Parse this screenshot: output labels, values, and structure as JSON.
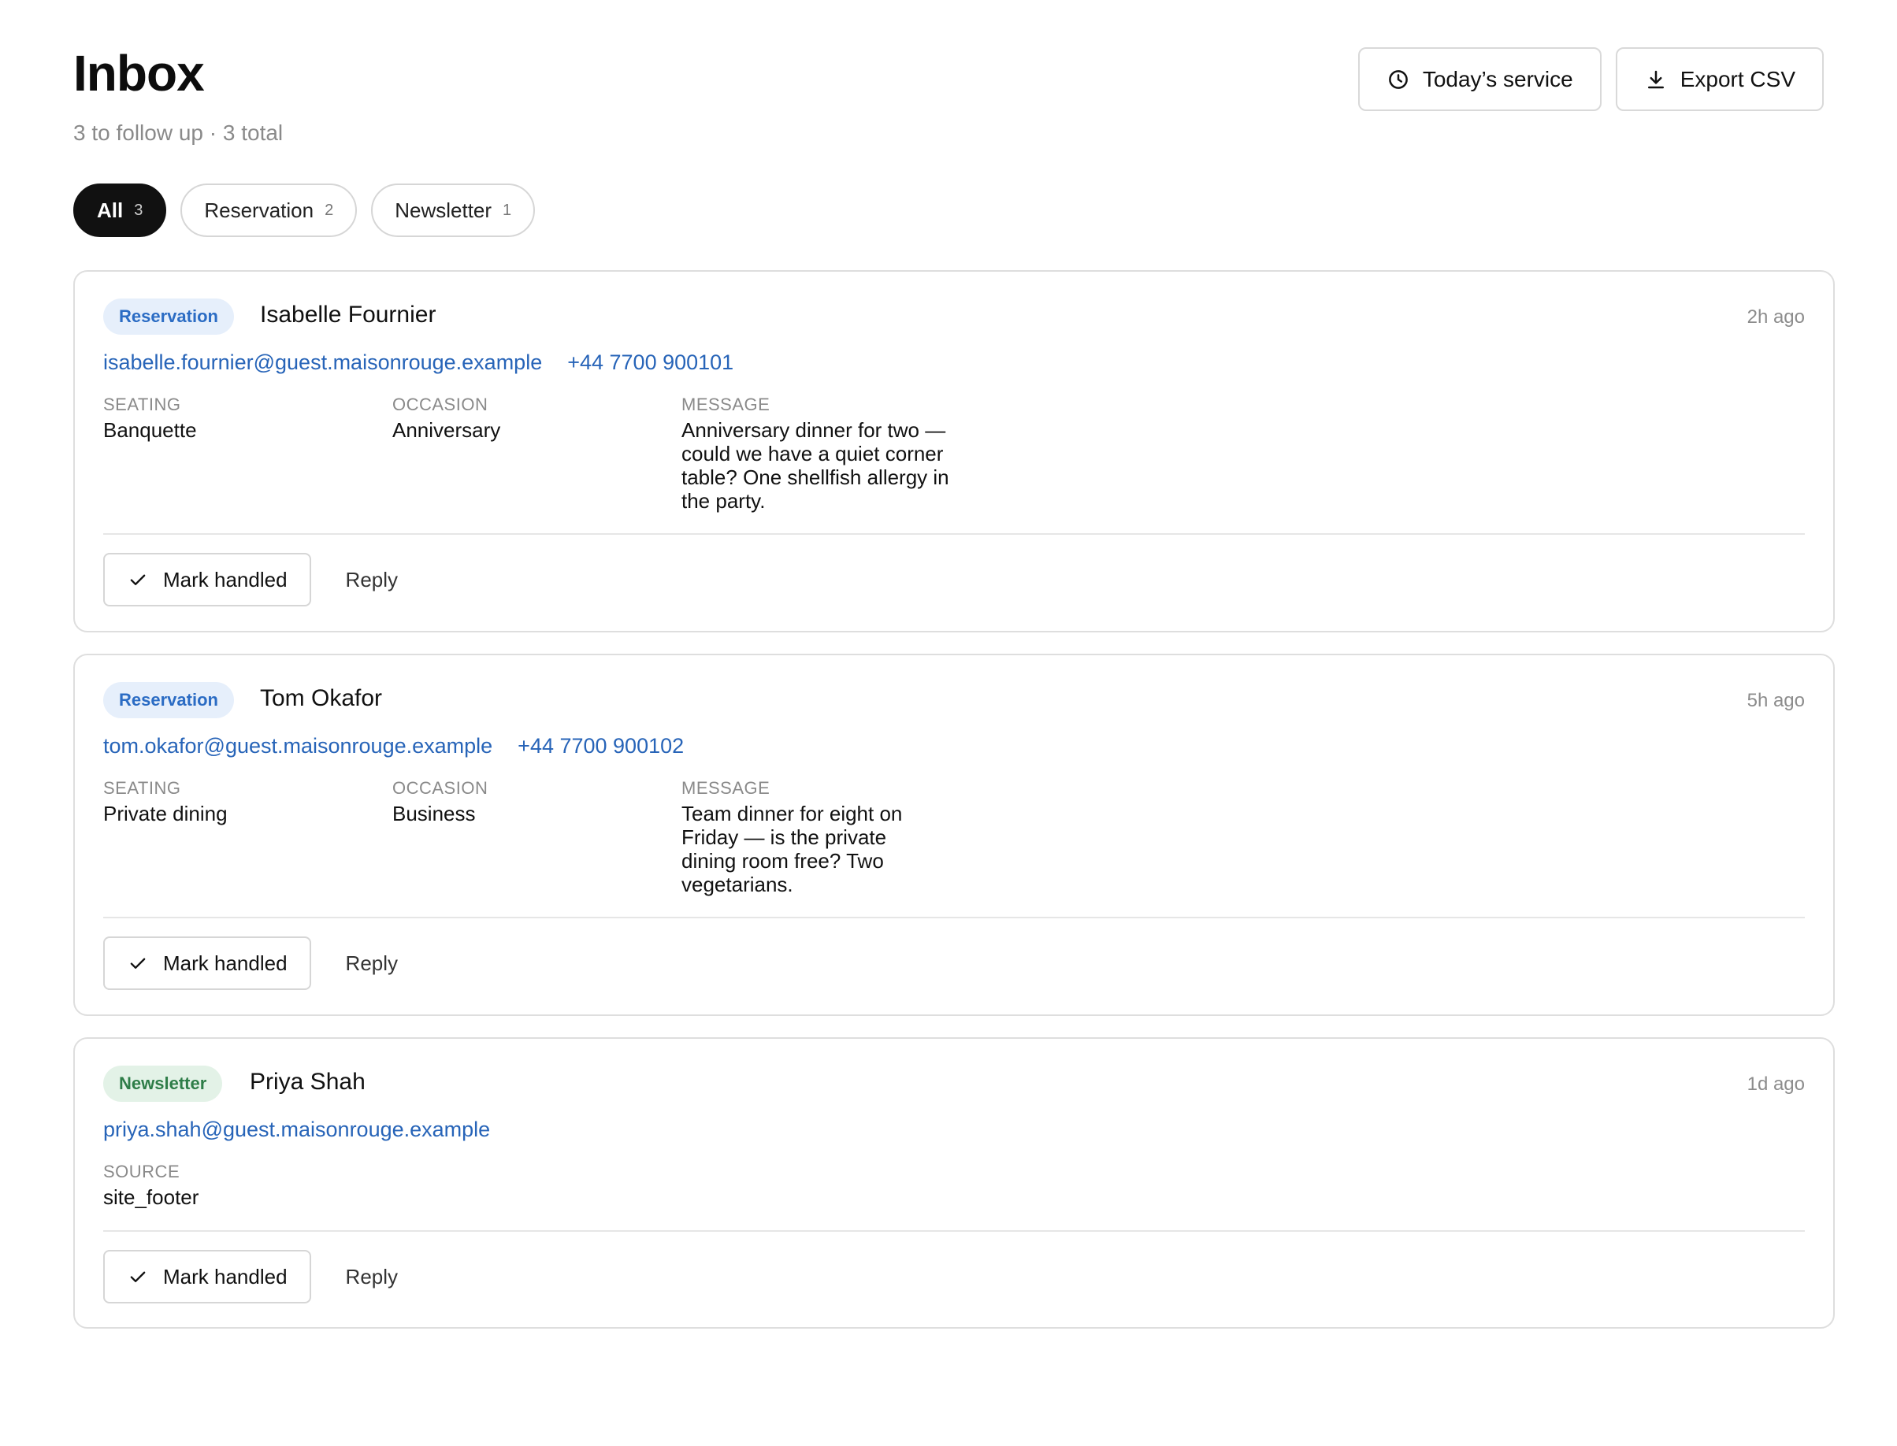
{
  "header": {
    "title": "Inbox",
    "subtitle": "3 to follow up · 3 total",
    "todays_service_label": "Today’s service",
    "export_label": "Export CSV"
  },
  "filters": [
    {
      "label": "All",
      "count": "3",
      "active": true
    },
    {
      "label": "Reservation",
      "count": "2",
      "active": false
    },
    {
      "label": "Newsletter",
      "count": "1",
      "active": false
    }
  ],
  "messages": [
    {
      "type": "Reservation",
      "name": "Isabelle Fournier",
      "time": "2h ago",
      "email": "isabelle.fournier@guest.maisonrouge.example",
      "phone": "+44 7700 900101",
      "seating_label": "SEATING",
      "seating": "Banquette",
      "occasion_label": "OCCASION",
      "occasion": "Anniversary",
      "message_label": "MESSAGE",
      "message": "Anniversary dinner for two — could we have a quiet corner table? One shellfish allergy in the party.",
      "handled_label": "Mark handled",
      "reply_label": "Reply"
    },
    {
      "type": "Reservation",
      "name": "Tom Okafor",
      "time": "5h ago",
      "email": "tom.okafor@guest.maisonrouge.example",
      "phone": "+44 7700 900102",
      "seating_label": "SEATING",
      "seating": "Private dining",
      "occasion_label": "OCCASION",
      "occasion": "Business",
      "message_label": "MESSAGE",
      "message": "Team dinner for eight on Friday — is the private dining room free? Two vegetarians.",
      "handled_label": "Mark handled",
      "reply_label": "Reply"
    },
    {
      "type": "Newsletter",
      "name": "Priya Shah",
      "time": "1d ago",
      "email": "priya.shah@guest.maisonrouge.example",
      "source_label": "SOURCE",
      "source": "site_footer",
      "handled_label": "Mark handled",
      "reply_label": "Reply"
    }
  ],
  "colors": {
    "reservation_badge_bg": "#e6effb",
    "reservation_badge_text": "#2b6cc4",
    "newsletter_badge_bg": "#e3f2e7",
    "newsletter_badge_text": "#2e7d48",
    "link": "#2764b8"
  },
  "icons": {
    "todays_service": "clock-icon",
    "export": "download-icon",
    "handled": "check-icon"
  }
}
